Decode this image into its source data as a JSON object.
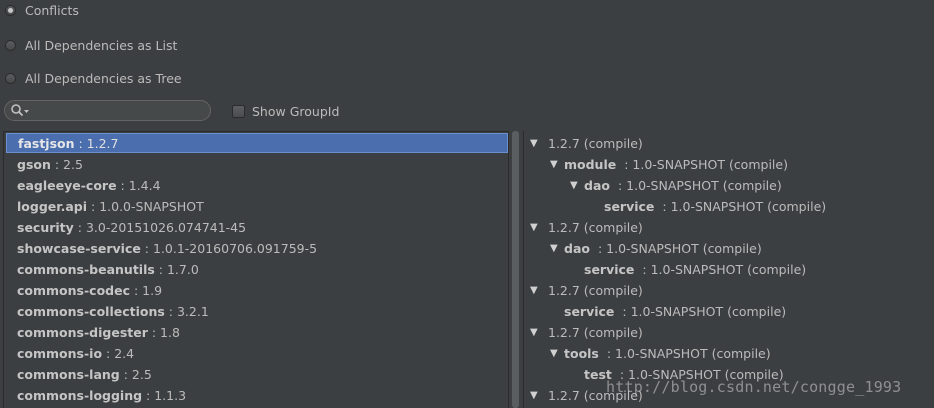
{
  "scope_options": [
    {
      "label": "Conflicts",
      "selected": true
    },
    {
      "label": "All Dependencies as List",
      "selected": false
    },
    {
      "label": "All Dependencies as Tree",
      "selected": false
    }
  ],
  "search": {
    "placeholder": ""
  },
  "show_group_id": {
    "label": "Show GroupId",
    "checked": false
  },
  "dependencies": [
    {
      "name": "fastjson",
      "version": " : 1.2.7",
      "selected": true
    },
    {
      "name": "gson",
      "version": " : 2.5"
    },
    {
      "name": "eagleeye-core",
      "version": " : 1.4.4"
    },
    {
      "name": "logger.api",
      "version": " : 1.0.0-SNAPSHOT"
    },
    {
      "name": "security",
      "version": " : 3.0-20151026.074741-45"
    },
    {
      "name": "showcase-service",
      "version": " : 1.0.1-20160706.091759-5"
    },
    {
      "name": "commons-beanutils",
      "version": " : 1.7.0"
    },
    {
      "name": "commons-codec",
      "version": " : 1.9"
    },
    {
      "name": "commons-collections",
      "version": " : 3.2.1"
    },
    {
      "name": "commons-digester",
      "version": " : 1.8"
    },
    {
      "name": "commons-io",
      "version": " : 2.4"
    },
    {
      "name": "commons-lang",
      "version": " : 2.5"
    },
    {
      "name": "commons-logging",
      "version": " : 1.1.3"
    }
  ],
  "usages": [
    {
      "level": 0,
      "expanded": true,
      "name": "",
      "detail": "1.2.7 (compile)"
    },
    {
      "level": 1,
      "expanded": true,
      "name": "module",
      "detail": " : 1.0-SNAPSHOT (compile)"
    },
    {
      "level": 2,
      "expanded": true,
      "name": "dao",
      "detail": " : 1.0-SNAPSHOT (compile)"
    },
    {
      "level": 3,
      "expanded": false,
      "name": "service",
      "detail": " : 1.0-SNAPSHOT (compile)"
    },
    {
      "level": 0,
      "expanded": true,
      "name": "",
      "detail": "1.2.7 (compile)"
    },
    {
      "level": 1,
      "expanded": true,
      "name": "dao",
      "detail": " : 1.0-SNAPSHOT (compile)"
    },
    {
      "level": 2,
      "expanded": false,
      "name": "service",
      "detail": " : 1.0-SNAPSHOT (compile)"
    },
    {
      "level": 0,
      "expanded": true,
      "name": "",
      "detail": "1.2.7 (compile)"
    },
    {
      "level": 1,
      "expanded": false,
      "name": "service",
      "detail": " : 1.0-SNAPSHOT (compile)"
    },
    {
      "level": 0,
      "expanded": true,
      "name": "",
      "detail": "1.2.7 (compile)"
    },
    {
      "level": 1,
      "expanded": true,
      "name": "tools",
      "detail": " : 1.0-SNAPSHOT (compile)"
    },
    {
      "level": 2,
      "expanded": false,
      "name": "test",
      "detail": " : 1.0-SNAPSHOT (compile)"
    },
    {
      "level": 0,
      "expanded": true,
      "name": "",
      "detail": "1.2.7 (compile)"
    }
  ],
  "watermark": "http://blog.csdn.net/congge_1993"
}
